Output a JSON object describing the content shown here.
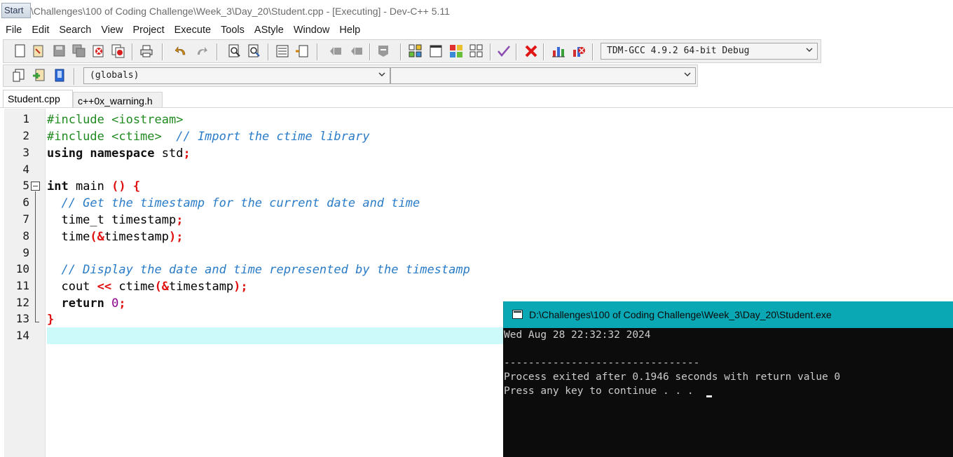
{
  "window": {
    "start_label": "Start",
    "title": "D:\\Challenges\\100 of Coding Challenge\\Week_3\\Day_20\\Student.cpp - [Executing] - Dev-C++ 5.11"
  },
  "menu": [
    "File",
    "Edit",
    "Search",
    "View",
    "Project",
    "Execute",
    "Tools",
    "AStyle",
    "Window",
    "Help"
  ],
  "toolbar": {
    "compiler_select": "TDM-GCC 4.9.2 64-bit Debug",
    "scope_select": "(globals)",
    "function_select": ""
  },
  "tabs": [
    "Student.cpp",
    "c++0x_warning.h"
  ],
  "editor": {
    "line_numbers": [
      "1",
      "2",
      "3",
      "4",
      "5",
      "6",
      "7",
      "8",
      "9",
      "10",
      "11",
      "12",
      "13",
      "14"
    ],
    "code": {
      "l1_pp": "#include <iostream>",
      "l2_pp": "#include <ctime>  ",
      "l2_cm": "// Import the ctime library",
      "l3_kw": "using namespace",
      "l3_tx": " std",
      "l3_sym": ";",
      "l5_kw": "int",
      "l5_tx": " main ",
      "l5_sym": "() {",
      "l6_cm": "  // Get the timestamp for the current date and time",
      "l7_tx": "  time_t timestamp",
      "l7_sym": ";",
      "l8_tx1": "  time",
      "l8_sym1": "(&",
      "l8_tx2": "timestamp",
      "l8_sym2": ");",
      "l10_cm": "  // Display the date and time represented by the timestamp",
      "l11_tx1": "  cout ",
      "l11_sym1": "<<",
      "l11_tx2": " ctime",
      "l11_sym2": "(&",
      "l11_tx3": "timestamp",
      "l11_sym3": ");",
      "l12_kw": "  return",
      "l12_num": " 0",
      "l12_sym": ";",
      "l13_sym": "}"
    }
  },
  "console": {
    "title": "D:\\Challenges\\100 of Coding Challenge\\Week_3\\Day_20\\Student.exe",
    "lines": [
      "Wed Aug 28 22:32:32 2024",
      "",
      "--------------------------------",
      "Process exited after 0.1946 seconds with return value 0",
      "Press any key to continue . . . "
    ]
  }
}
